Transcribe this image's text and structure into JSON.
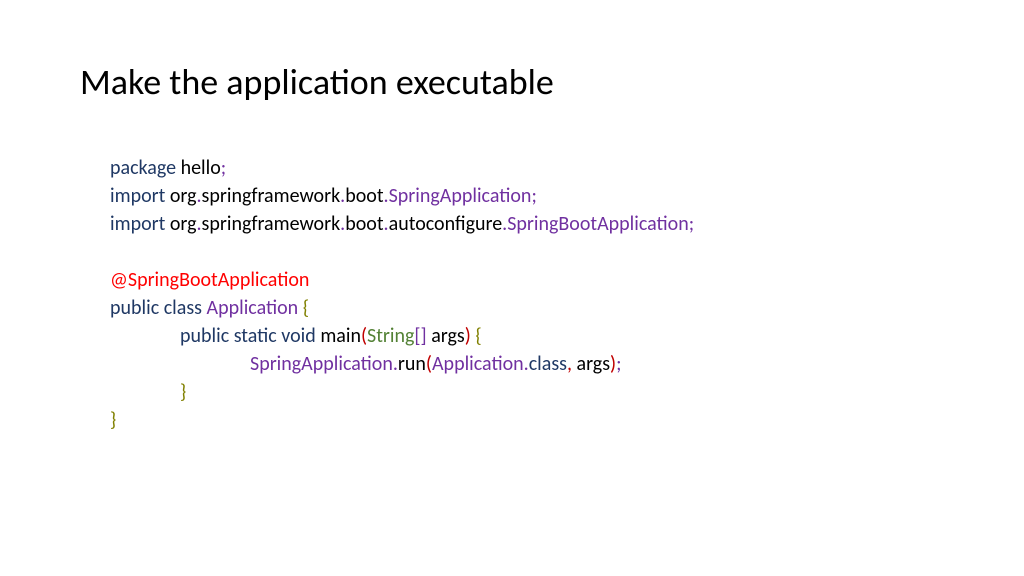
{
  "title": "Make the application executable",
  "code": {
    "line1": {
      "package": "package",
      "hello": " hello",
      "semi": ";"
    },
    "line2": {
      "import": "import",
      "org": " org",
      "dot1": ".",
      "spring": "springframework",
      "dot2": ".",
      "boot": "boot",
      "dot3": ".",
      "class": "SpringApplication",
      "semi": ";"
    },
    "line3": {
      "import": "import",
      "org": " org",
      "dot1": ".",
      "spring": "springframework",
      "dot2": ".",
      "boot": "boot",
      "dot3": ".",
      "auto": "autoconfigure",
      "dot4": ".",
      "class": "SpringBootApplication",
      "semi": ";"
    },
    "line4": {
      "annotation": "@SpringBootApplication"
    },
    "line5": {
      "public": "public",
      "sp1": " ",
      "class": "class",
      "sp2": " ",
      "app": "Application",
      "sp3": " ",
      "brace": "{"
    },
    "line6": {
      "public": "public",
      "sp1": " ",
      "static": "static",
      "sp2": " ",
      "void": "void",
      "sp3": " ",
      "main": "main",
      "lparen": "(",
      "string": "String",
      "brackets": "[]",
      "sp4": " ",
      "args": "args",
      "rparen": ")",
      "sp5": " ",
      "brace": "{"
    },
    "line7": {
      "springapp": "SpringApplication",
      "dot1": ".",
      "run": "run",
      "lparen": "(",
      "app": "Application",
      "dot2": ".",
      "class": "class",
      "comma": ",",
      "sp": " ",
      "args": "args",
      "rparen": ")",
      "semi": ";"
    },
    "line8": {
      "brace": "}"
    },
    "line9": {
      "brace": "}"
    }
  }
}
